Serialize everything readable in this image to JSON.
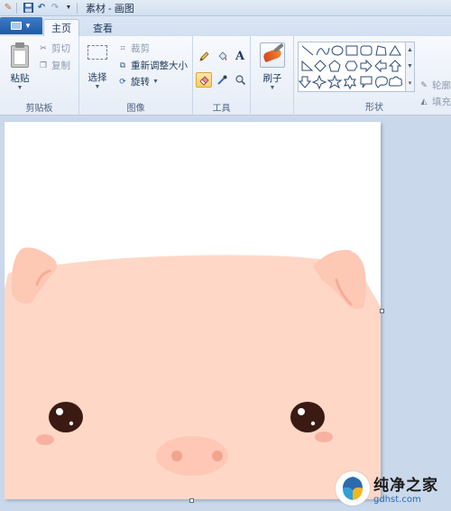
{
  "window": {
    "title": "素材 - 画图"
  },
  "quick_access": {
    "icons": [
      "paint-app-icon",
      "save-icon",
      "undo-icon",
      "redo-icon",
      "customize-dropdown-icon"
    ]
  },
  "tabs": [
    {
      "label": "主页",
      "selected": true
    },
    {
      "label": "查看",
      "selected": false
    }
  ],
  "ribbon": {
    "clipboard": {
      "paste_label": "粘贴",
      "cut_label": "剪切",
      "copy_label": "复制",
      "group_label": "剪贴板"
    },
    "image": {
      "select_label": "选择",
      "crop_label": "裁剪",
      "resize_label": "重新调整大小",
      "rotate_label": "旋转",
      "group_label": "图像"
    },
    "tools": {
      "group_label": "工具",
      "items": [
        "pencil-icon",
        "fill-icon",
        "text-icon",
        "eraser-icon",
        "color-picker-icon",
        "magnifier-icon"
      ],
      "active": "eraser-icon"
    },
    "brush": {
      "label": "刷子"
    },
    "shapes": {
      "group_label": "形状",
      "outline_label": "轮廓",
      "fill_label": "填充"
    }
  },
  "colors": {
    "accent": "#1f5aa6",
    "pig_skin": "#ffd7c6",
    "pig_ear": "#fac0ad",
    "pig_cheek": "#f5a494",
    "pig_snout": "#fec7b6",
    "pig_nostril": "#f3a48f",
    "eye": "#3a1a12"
  },
  "watermark": {
    "title": "纯净之家",
    "url": "gdhst.com"
  }
}
